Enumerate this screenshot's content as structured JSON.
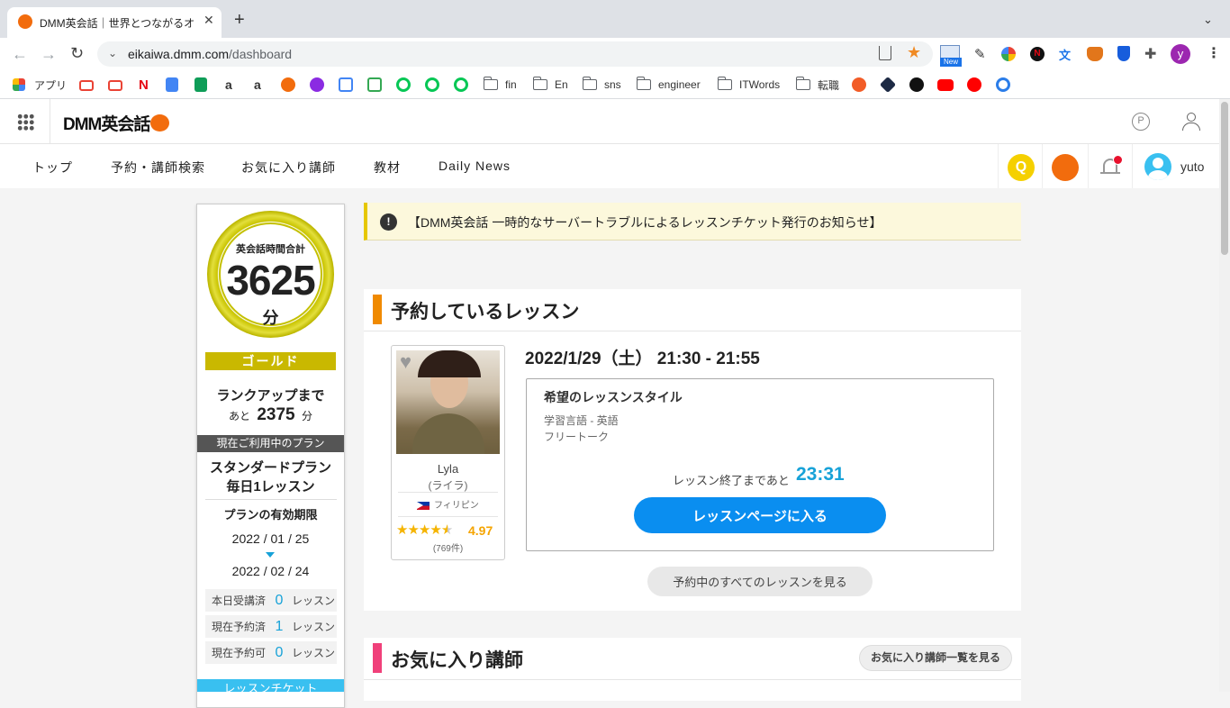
{
  "browser": {
    "tab_title": "DMM英会話｜世界とつながるオン",
    "url_domain": "eikaiwa.dmm.com",
    "url_path": "/dashboard",
    "new_badge": "New",
    "profile_initial": "y",
    "bookmarks": {
      "apps": "アプリ",
      "fin": "fin",
      "en": "En",
      "sns": "sns",
      "engineer": "engineer",
      "itwords": "ITWords",
      "tenshoku": "転職"
    }
  },
  "site": {
    "logo_text": "DMM英会話",
    "nav": [
      "トップ",
      "予約・講師検索",
      "お気に入り講師",
      "教材",
      "Daily News"
    ],
    "user_name": "yuto",
    "q_icon_label": "Q"
  },
  "sidebar": {
    "total_label": "英会話時間合計",
    "total_minutes": "3625",
    "minutes_unit": "分",
    "rank": "ゴールド",
    "rankup_label": "ランクアップまで",
    "rankup_prefix": "あと",
    "rankup_value": "2375",
    "rankup_unit": "分",
    "plan_header": "現在ご利用中のプラン",
    "plan_name_1": "スタンダードプラン",
    "plan_name_2": "毎日1レッスン",
    "validity_label": "プランの有効期限",
    "date_start": "2022 / 01 / 25",
    "date_end": "2022 / 02 / 24",
    "stats": [
      {
        "label": "本日受講済",
        "value": "0",
        "unit": "レッスン"
      },
      {
        "label": "現在予約済",
        "value": "1",
        "unit": "レッスン"
      },
      {
        "label": "現在予約可",
        "value": "0",
        "unit": "レッスン"
      }
    ],
    "ticket_label": "レッスンチケット"
  },
  "alert": {
    "icon": "!",
    "text": "【DMM英会話 一時的なサーバートラブルによるレッスンチケット発行のお知らせ】"
  },
  "reserved": {
    "title": "予約しているレッスン",
    "datetime": "2022/1/29（土） 21:30 - 21:55",
    "teacher_name": "Lyla",
    "teacher_kana": "(ライラ)",
    "teacher_country": "フィリピン",
    "rating": "4.97",
    "rating_stars_fraction": 0.97,
    "review_count": "(769件)",
    "style_title": "希望のレッスンスタイル",
    "style_line1": "学習言語 - 英語",
    "style_line2": "フリートーク",
    "countdown_label": "レッスン終了まであと",
    "countdown_value": "23:31",
    "enter_button": "レッスンページに入る",
    "all_button": "予約中のすべてのレッスンを見る"
  },
  "favorites": {
    "title": "お気に入り講師",
    "view_all": "お気に入り講師一覧を見る"
  },
  "colors": {
    "accent_orange": "#f08a00",
    "accent_pink": "#f0407a",
    "blue": "#0a8ef0",
    "gold": "#c9c400"
  }
}
